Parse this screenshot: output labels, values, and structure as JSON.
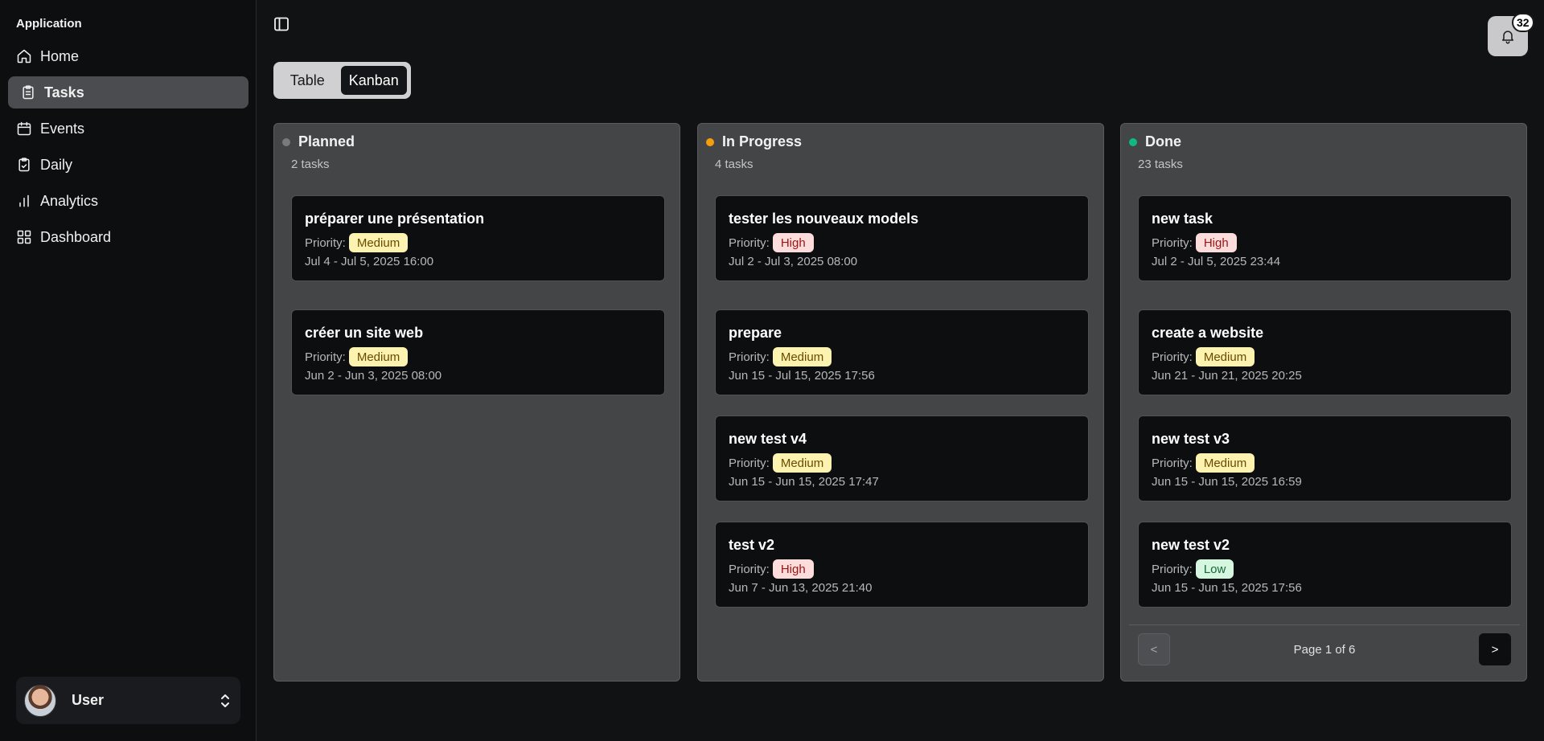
{
  "sidebar": {
    "app_label": "Application",
    "items": [
      {
        "label": "Home",
        "icon": "home-icon"
      },
      {
        "label": "Tasks",
        "icon": "clipboard-icon",
        "active": true
      },
      {
        "label": "Events",
        "icon": "calendar-icon"
      },
      {
        "label": "Daily",
        "icon": "calendar-check-icon"
      },
      {
        "label": "Analytics",
        "icon": "bar-chart-icon"
      },
      {
        "label": "Dashboard",
        "icon": "dashboard-icon"
      }
    ],
    "user": {
      "name": "User"
    }
  },
  "header": {
    "notification_count": "32"
  },
  "view_toggle": {
    "table_label": "Table",
    "kanban_label": "Kanban",
    "selected": "Kanban"
  },
  "colors": {
    "planned": "#7a7a7e",
    "in_progress": "#f59e0b",
    "done": "#10b981",
    "medium_bg": "#fcf3b0",
    "high_bg": "#fddcdc",
    "low_bg": "#d6f7df"
  },
  "columns": [
    {
      "title": "Planned",
      "count": "2 tasks",
      "cards": [
        {
          "title": "préparer une présentation",
          "priority_label": "Priority:",
          "priority": "Medium",
          "date": "Jul 4 - Jul 5, 2025 16:00"
        },
        {
          "title": "créer un site web",
          "priority_label": "Priority:",
          "priority": "Medium",
          "date": "Jun 2 - Jun 3, 2025 08:00"
        }
      ]
    },
    {
      "title": "In Progress",
      "count": "4 tasks",
      "cards": [
        {
          "title": "tester les nouveaux models",
          "priority_label": "Priority:",
          "priority": "High",
          "date": "Jul 2 - Jul 3, 2025 08:00"
        },
        {
          "title": "prepare",
          "priority_label": "Priority:",
          "priority": "Medium",
          "date": "Jun 15 - Jul 15, 2025 17:56"
        },
        {
          "title": "new test v4",
          "priority_label": "Priority:",
          "priority": "Medium",
          "date": "Jun 15 - Jun 15, 2025 17:47"
        },
        {
          "title": "test v2",
          "priority_label": "Priority:",
          "priority": "High",
          "date": "Jun 7 - Jun 13, 2025 21:40"
        }
      ]
    },
    {
      "title": "Done",
      "count": "23 tasks",
      "cards": [
        {
          "title": "new task",
          "priority_label": "Priority:",
          "priority": "High",
          "date": "Jul 2 - Jul 5, 2025 23:44"
        },
        {
          "title": "create a website",
          "priority_label": "Priority:",
          "priority": "Medium",
          "date": "Jun 21 - Jun 21, 2025 20:25"
        },
        {
          "title": "new test v3",
          "priority_label": "Priority:",
          "priority": "Medium",
          "date": "Jun 15 - Jun 15, 2025 16:59"
        },
        {
          "title": "new test v2",
          "priority_label": "Priority:",
          "priority": "Low",
          "date": "Jun 15 - Jun 15, 2025 17:56"
        }
      ],
      "pagination": {
        "prev": "<",
        "next": ">",
        "text": "Page 1 of 6"
      }
    }
  ]
}
